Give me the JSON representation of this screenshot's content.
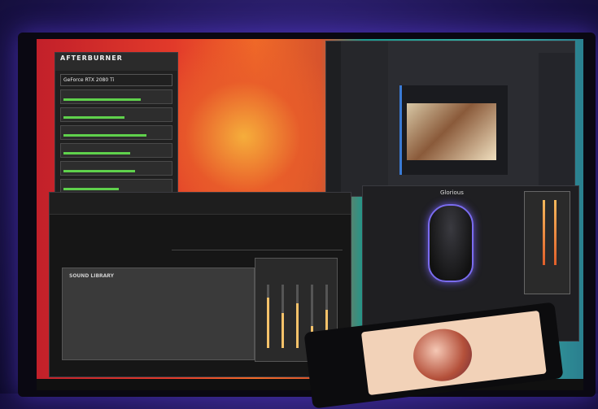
{
  "scene": {
    "description_visible_text": {
      "hardware_panel_title": "AFTERBURNER",
      "gpu_name": "GeForce RTX 2080 Ti",
      "mouse_software_brand": "Glorious",
      "sound_section_label": "SOUND LIBRARY"
    },
    "hardware_rows": [
      "",
      "",
      "",
      "",
      "",
      ""
    ],
    "bar_levels": [
      0.7,
      0.55,
      0.75,
      0.6,
      0.65,
      0.5
    ],
    "eq_levels": [
      0.8,
      0.55,
      0.7,
      0.35,
      0.6
    ],
    "colors": {
      "accent_glow": "#7a6cf0",
      "wallpaper_red": "#e23a2a",
      "wallpaper_teal": "#1b9a8f"
    }
  }
}
